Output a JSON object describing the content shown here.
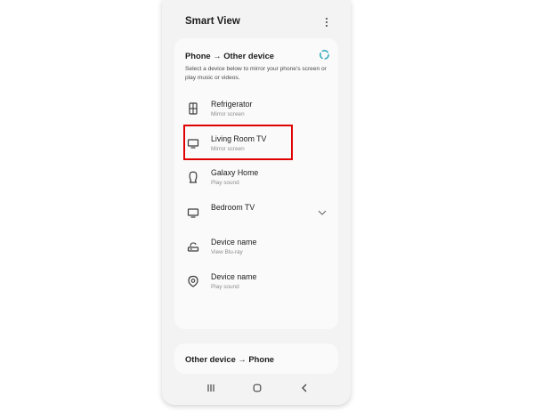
{
  "app": {
    "title": "Smart View",
    "more_icon": "more-vertical-icon"
  },
  "phone_to_device": {
    "title": "Phone → Other device",
    "description": "Select a device below to mirror your phone's screen or play music or videos.",
    "loading_icon": "loading-spinner-icon",
    "accent_color": "#2aa7b8",
    "devices": [
      {
        "name": "Refrigerator",
        "subtitle": "Mirror screen",
        "icon": "refrigerator-icon"
      },
      {
        "name": "Living Room TV",
        "subtitle": "Mirror screen",
        "icon": "tv-icon"
      },
      {
        "name": "Galaxy Home",
        "subtitle": "Play sound",
        "icon": "speaker-icon"
      },
      {
        "name": "Bedroom TV",
        "subtitle": "",
        "icon": "tv-icon",
        "expand_icon": "chevron-down-icon"
      },
      {
        "name": "Device name",
        "subtitle": "View Blu-ray",
        "icon": "bluray-player-icon"
      },
      {
        "name": "Device name",
        "subtitle": "Play sound",
        "icon": "smart-tag-icon"
      }
    ]
  },
  "device_to_phone": {
    "title": "Other device → Phone"
  },
  "navbar": {
    "recents_icon": "recents-icon",
    "home_icon": "home-icon",
    "back_icon": "back-icon"
  },
  "annotation": {
    "highlight_color": "#e00000",
    "highlighted_item": "Living Room TV"
  }
}
